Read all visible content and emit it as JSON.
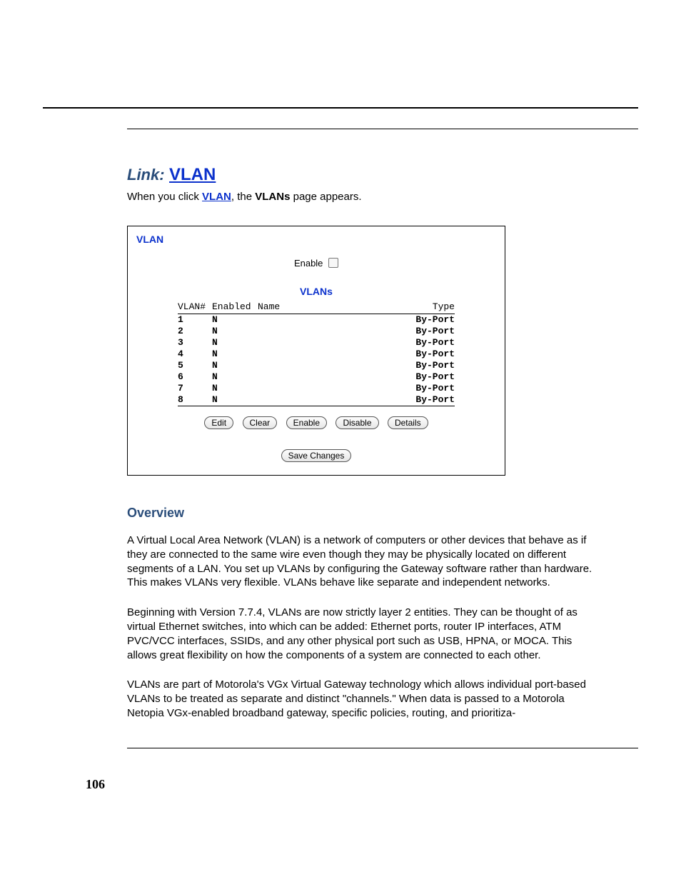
{
  "heading": {
    "prefix": "Link:",
    "title": "VLAN"
  },
  "intro": {
    "pre": "When you click ",
    "link": "VLAN",
    "mid": ", the ",
    "bold": "VLANs",
    "post": " page appears."
  },
  "panel": {
    "title": "VLAN",
    "enable_label": "Enable",
    "subtitle": "VLANs",
    "columns": {
      "num": "VLAN#",
      "enabled": "Enabled",
      "name": "Name",
      "type": "Type"
    },
    "rows": [
      {
        "num": "1",
        "enabled": "N",
        "name": "",
        "type": "By-Port"
      },
      {
        "num": "2",
        "enabled": "N",
        "name": "",
        "type": "By-Port"
      },
      {
        "num": "3",
        "enabled": "N",
        "name": "",
        "type": "By-Port"
      },
      {
        "num": "4",
        "enabled": "N",
        "name": "",
        "type": "By-Port"
      },
      {
        "num": "5",
        "enabled": "N",
        "name": "",
        "type": "By-Port"
      },
      {
        "num": "6",
        "enabled": "N",
        "name": "",
        "type": "By-Port"
      },
      {
        "num": "7",
        "enabled": "N",
        "name": "",
        "type": "By-Port"
      },
      {
        "num": "8",
        "enabled": "N",
        "name": "",
        "type": "By-Port"
      }
    ],
    "buttons": {
      "edit": "Edit",
      "clear": "Clear",
      "enable": "Enable",
      "disable": "Disable",
      "details": "Details",
      "save": "Save Changes"
    }
  },
  "overview": {
    "heading": "Overview",
    "p1": "A Virtual Local Area Network (VLAN) is a network of computers or other devices that behave as if they are connected to the same wire even though they may be physically located on different segments of a LAN. You set up VLANs by configuring the Gateway software rather than hardware. This makes VLANs very flexible. VLANs behave like separate and independent networks.",
    "p2": "Beginning with Version 7.7.4, VLANs are now strictly layer 2 entities. They can be thought of as virtual Ethernet switches, into which can be added: Ethernet ports, router IP interfaces, ATM PVC/VCC interfaces, SSIDs, and any other physical port such as USB, HPNA, or MOCA. This allows great flexibility on how the components of a system are connected to each other.",
    "p3": "VLANs are part of Motorola's VGx Virtual Gateway technology which allows individual port-based VLANs to be treated as separate and distinct \"channels.\" When data is passed to a Motorola Netopia VGx-enabled broadband gateway, specific policies, routing, and prioritiza-"
  },
  "page_number": "106"
}
